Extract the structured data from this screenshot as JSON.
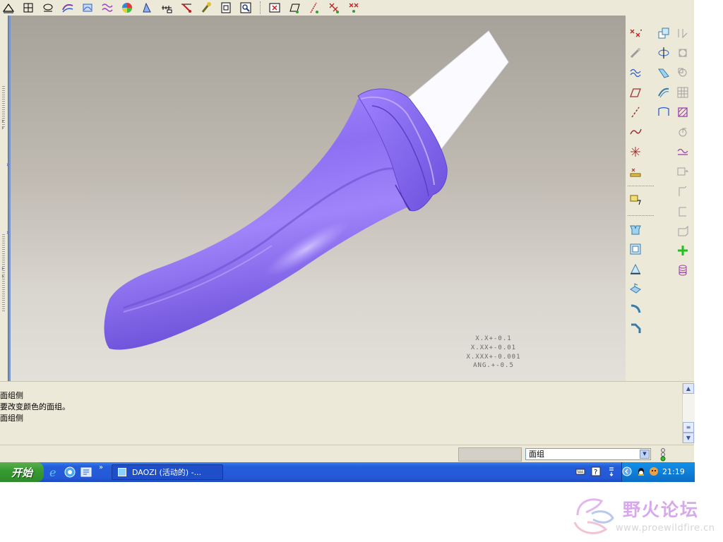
{
  "toolbar": {
    "icons_group1": [
      "datum-plane-icon",
      "datum-table-icon",
      "datum-point-icon",
      "shade-icon",
      "spin-icon",
      "wave-icon",
      "color-palette-icon",
      "surface-analysis-icon",
      "ruler-icon",
      "measure-icon",
      "repaint-icon",
      "window-icon",
      "zoom-icon"
    ],
    "icons_group2": [
      "close-box-icon",
      "plane-display-icon",
      "axis-display-icon",
      "point-display-icon",
      "csys-display-icon"
    ]
  },
  "viewport": {
    "tolerance_lines": [
      "X.X+-0.1",
      "X.XX+-0.01",
      "X.XXX+-0.001",
      "ANG.+-0.5"
    ]
  },
  "right_panel": {
    "left_column": [
      "datum-point-icon",
      "sketch-icon",
      "curve-icon",
      "plane-icon",
      "axis-icon",
      "spline-icon",
      "csys-icon",
      "offset-icon",
      "note-icon",
      "extrude-icon",
      "shell-icon",
      "draft-icon",
      "rib-icon",
      "round-icon",
      "chamfer-icon"
    ],
    "right_column": [
      "copy-icon",
      "revolve-icon",
      "sweep-icon",
      "blend-icon",
      "boundary-icon",
      "fill-icon",
      "pattern-icon",
      "mirror-icon",
      "trim-icon",
      "extend-icon",
      "merge-icon",
      "intersect-icon",
      "solidify-icon",
      "add-icon",
      "cylinder-icon"
    ]
  },
  "messages": [
    "面组侧",
    "要改变颜色的面组。",
    "面组侧"
  ],
  "status": {
    "filter_value": "面组"
  },
  "taskbar": {
    "start_label": "开始",
    "more_glyph": "»",
    "task_label": "DAOZI (活动的) -...",
    "clock": "21:19"
  },
  "watermark": {
    "title": "野火论坛",
    "url": "www.proewildfire.cn"
  },
  "colors": {
    "model_body": "#8b6bf0",
    "model_shadow": "#5a3fc8",
    "taskbar": "#245edb",
    "start_green": "#379c31"
  }
}
